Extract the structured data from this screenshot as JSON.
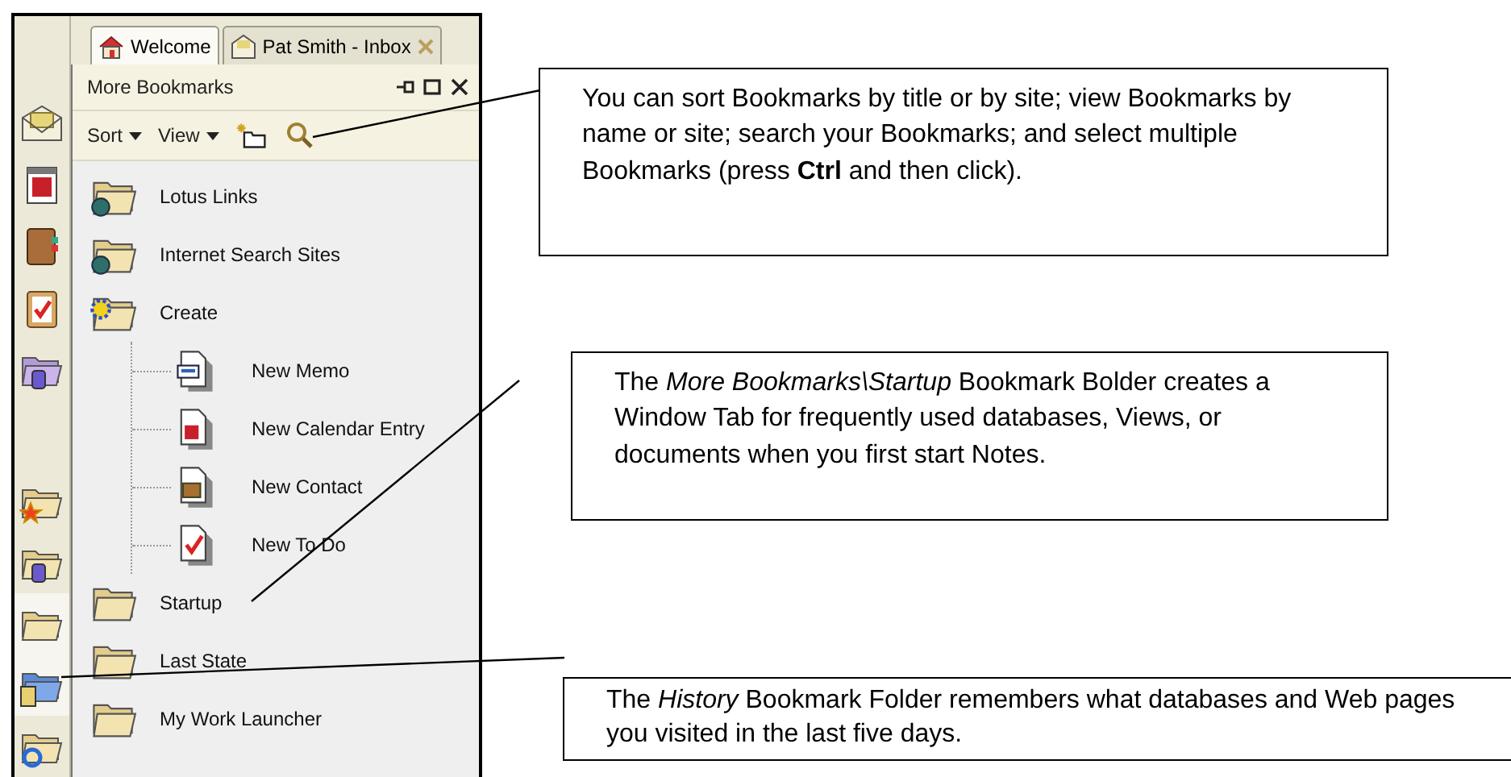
{
  "tabs": [
    {
      "label": "Welcome",
      "kind": "home",
      "selected": true,
      "closable": false
    },
    {
      "label": "Pat Smith - Inbox",
      "kind": "mail",
      "selected": false,
      "closable": true
    }
  ],
  "sidebar": {
    "items": [
      {
        "kind": "mail",
        "selected": false
      },
      {
        "kind": "calendar",
        "selected": false
      },
      {
        "kind": "contacts",
        "selected": false
      },
      {
        "kind": "todo",
        "selected": false
      },
      {
        "kind": "databases",
        "selected": false
      },
      {
        "kind": "gap",
        "selected": false
      },
      {
        "kind": "favorites",
        "selected": false
      },
      {
        "kind": "workspace",
        "selected": false
      },
      {
        "kind": "folder",
        "selected": true
      },
      {
        "kind": "history",
        "selected": true
      },
      {
        "kind": "web",
        "selected": false
      }
    ]
  },
  "panel": {
    "title": "More Bookmarks",
    "toolbar": [
      {
        "label": "Sort",
        "kind": "menu"
      },
      {
        "label": "View",
        "kind": "menu"
      },
      {
        "kind": "new-folder"
      },
      {
        "kind": "search"
      }
    ],
    "items": [
      {
        "label": "Lotus Links",
        "kind": "globe"
      },
      {
        "label": "Internet Search Sites",
        "kind": "search"
      },
      {
        "label": "Create",
        "kind": "create",
        "children": [
          {
            "label": "New Memo",
            "kind": "memo"
          },
          {
            "label": "New Calendar Entry",
            "kind": "calendar"
          },
          {
            "label": "New Contact",
            "kind": "contact"
          },
          {
            "label": "New To Do",
            "kind": "todo"
          }
        ]
      },
      {
        "label": "Startup",
        "kind": "folder"
      },
      {
        "label": "Last State",
        "kind": "folder"
      },
      {
        "label": "My Work Launcher",
        "kind": "folder"
      }
    ]
  },
  "callouts": [
    {
      "text": "You can sort Bookmarks by title or by site; view Bookmarks by name or site; search your Bookmarks; and select multiple Bookmarks (press **Ctrl** and then click)."
    },
    {
      "text": "The *More Bookmarks\\Startup* Bookmark Bolder creates a Window Tab for frequently used databases, Views, or documents when you first start Notes."
    },
    {
      "text": "The *History* Bookmark Folder remembers what databases and Web pages you visited in the last five days."
    }
  ]
}
